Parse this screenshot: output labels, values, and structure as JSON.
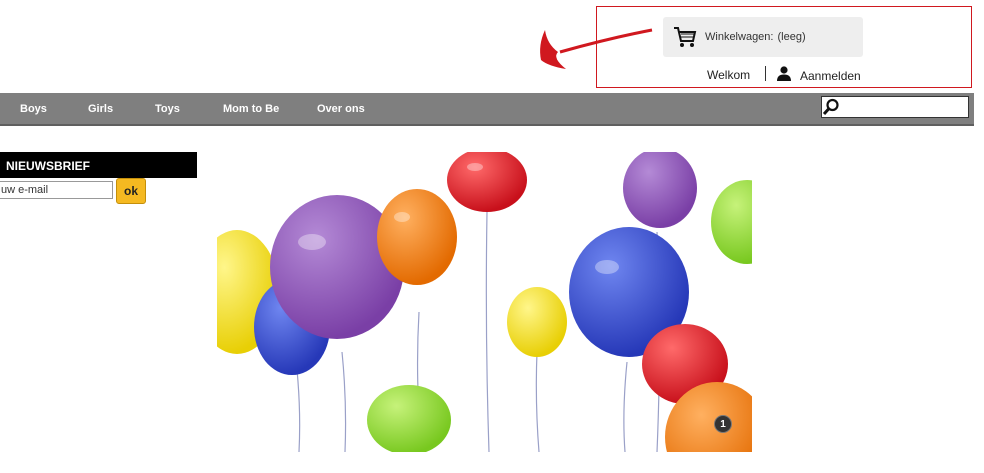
{
  "cart": {
    "label": "Winkelwagen:",
    "status": "(leeg)",
    "icon": "shopping-cart-icon"
  },
  "account": {
    "welcome": "Welkom",
    "login": "Aanmelden",
    "icon": "user-icon"
  },
  "nav": {
    "items": [
      "Boys",
      "Girls",
      "Toys",
      "Mom to Be",
      "Over ons"
    ]
  },
  "search": {
    "value": "",
    "placeholder": "",
    "icon": "magnifier-icon"
  },
  "newsletter": {
    "title": "NIEUWSBRIEF",
    "email_value": "uw e-mail",
    "ok_label": "ok"
  },
  "slider": {
    "current": "1"
  },
  "colors": {
    "nav_bg": "#7f7f7f",
    "ok_button": "#f5b921",
    "annotation": "#d0181f"
  }
}
